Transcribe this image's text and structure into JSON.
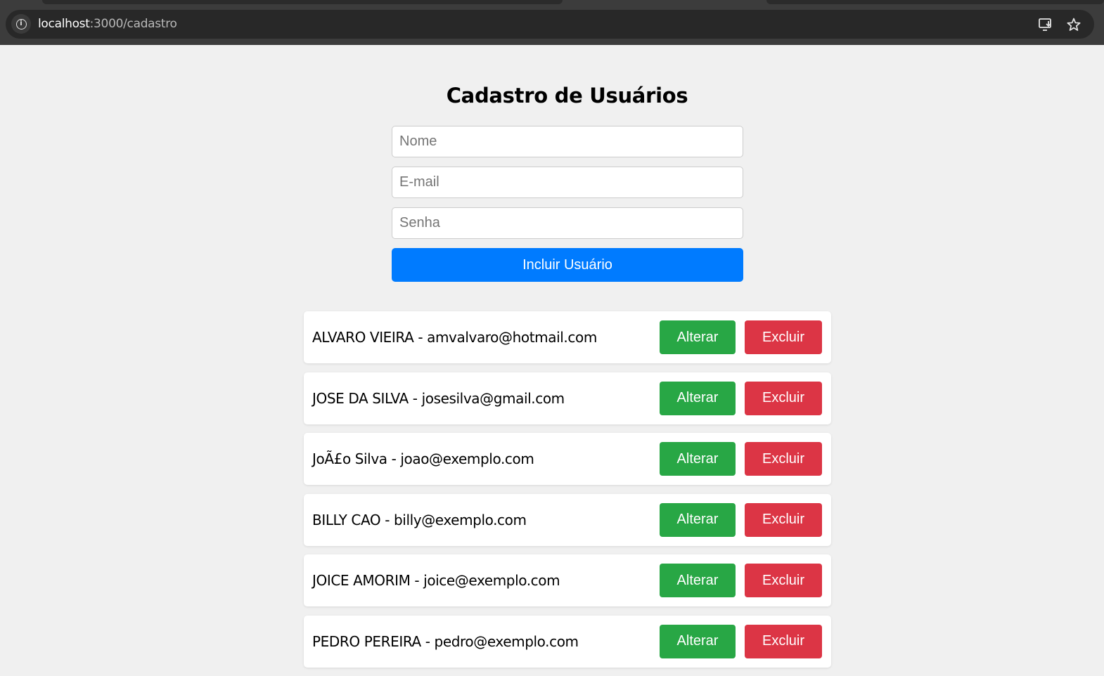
{
  "browser": {
    "url_host": "localhost",
    "url_path": ":3000/cadastro"
  },
  "page": {
    "title": "Cadastro de Usuários"
  },
  "form": {
    "name_placeholder": "Nome",
    "email_placeholder": "E-mail",
    "password_placeholder": "Senha",
    "submit_label": "Incluir Usuário"
  },
  "users": [
    {
      "text": "ALVARO VIEIRA - amvalvaro@hotmail.com",
      "edit_label": "Alterar",
      "delete_label": "Excluir"
    },
    {
      "text": "JOSE DA SILVA - josesilva@gmail.com",
      "edit_label": "Alterar",
      "delete_label": "Excluir"
    },
    {
      "text": "JoÃ£o Silva - joao@exemplo.com",
      "edit_label": "Alterar",
      "delete_label": "Excluir"
    },
    {
      "text": "BILLY CAO - billy@exemplo.com",
      "edit_label": "Alterar",
      "delete_label": "Excluir"
    },
    {
      "text": "JOICE AMORIM - joice@exemplo.com",
      "edit_label": "Alterar",
      "delete_label": "Excluir"
    },
    {
      "text": "PEDRO PEREIRA - pedro@exemplo.com",
      "edit_label": "Alterar",
      "delete_label": "Excluir"
    }
  ],
  "colors": {
    "primary": "#007bff",
    "edit": "#28a745",
    "delete": "#dc3545",
    "background": "#f0f0f0"
  },
  "icons": {
    "site_info": "info-icon",
    "install": "install-app-icon",
    "bookmark": "star-icon"
  }
}
